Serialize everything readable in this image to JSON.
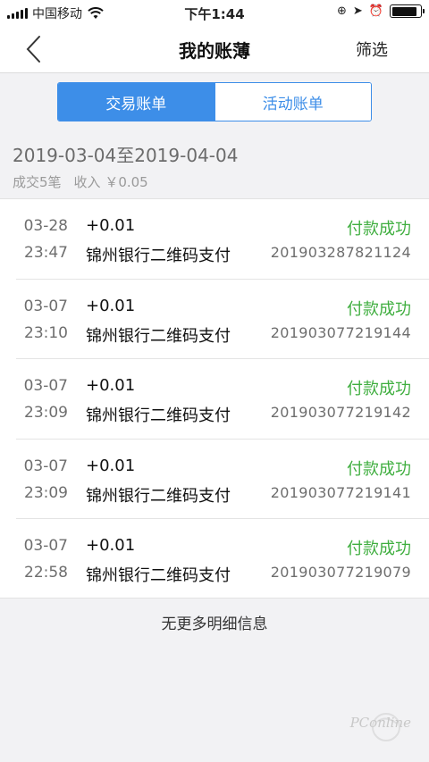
{
  "status_bar": {
    "carrier": "中国移动",
    "time": "下午1:44",
    "battery_level": 0.9
  },
  "nav": {
    "title": "我的账薄",
    "filter_label": "筛选"
  },
  "tabs": [
    {
      "label": "交易账单",
      "active": true
    },
    {
      "label": "活动账单",
      "active": false
    }
  ],
  "summary": {
    "date_range": "2019-03-04至2019-04-04",
    "count_text": "成交5笔",
    "income_text": "收入 ￥0.05"
  },
  "transactions": [
    {
      "date": "03-28",
      "time": "23:47",
      "amount": "+0.01",
      "merchant": "锦州银行二维码支付",
      "status": "付款成功",
      "order_no": "201903287821124"
    },
    {
      "date": "03-07",
      "time": "23:10",
      "amount": "+0.01",
      "merchant": "锦州银行二维码支付",
      "status": "付款成功",
      "order_no": "201903077219144"
    },
    {
      "date": "03-07",
      "time": "23:09",
      "amount": "+0.01",
      "merchant": "锦州银行二维码支付",
      "status": "付款成功",
      "order_no": "201903077219142"
    },
    {
      "date": "03-07",
      "time": "23:09",
      "amount": "+0.01",
      "merchant": "锦州银行二维码支付",
      "status": "付款成功",
      "order_no": "201903077219141"
    },
    {
      "date": "03-07",
      "time": "22:58",
      "amount": "+0.01",
      "merchant": "锦州银行二维码支付",
      "status": "付款成功",
      "order_no": "201903077219079"
    }
  ],
  "footer": {
    "no_more_text": "无更多明细信息"
  },
  "watermark": {
    "text": "PConline"
  },
  "colors": {
    "accent": "#3d8ee8",
    "success": "#3fae3f",
    "background": "#f2f2f4"
  },
  "icons": {
    "back": "chevron-left-icon",
    "wifi": "wifi-icon",
    "battery": "battery-icon"
  }
}
